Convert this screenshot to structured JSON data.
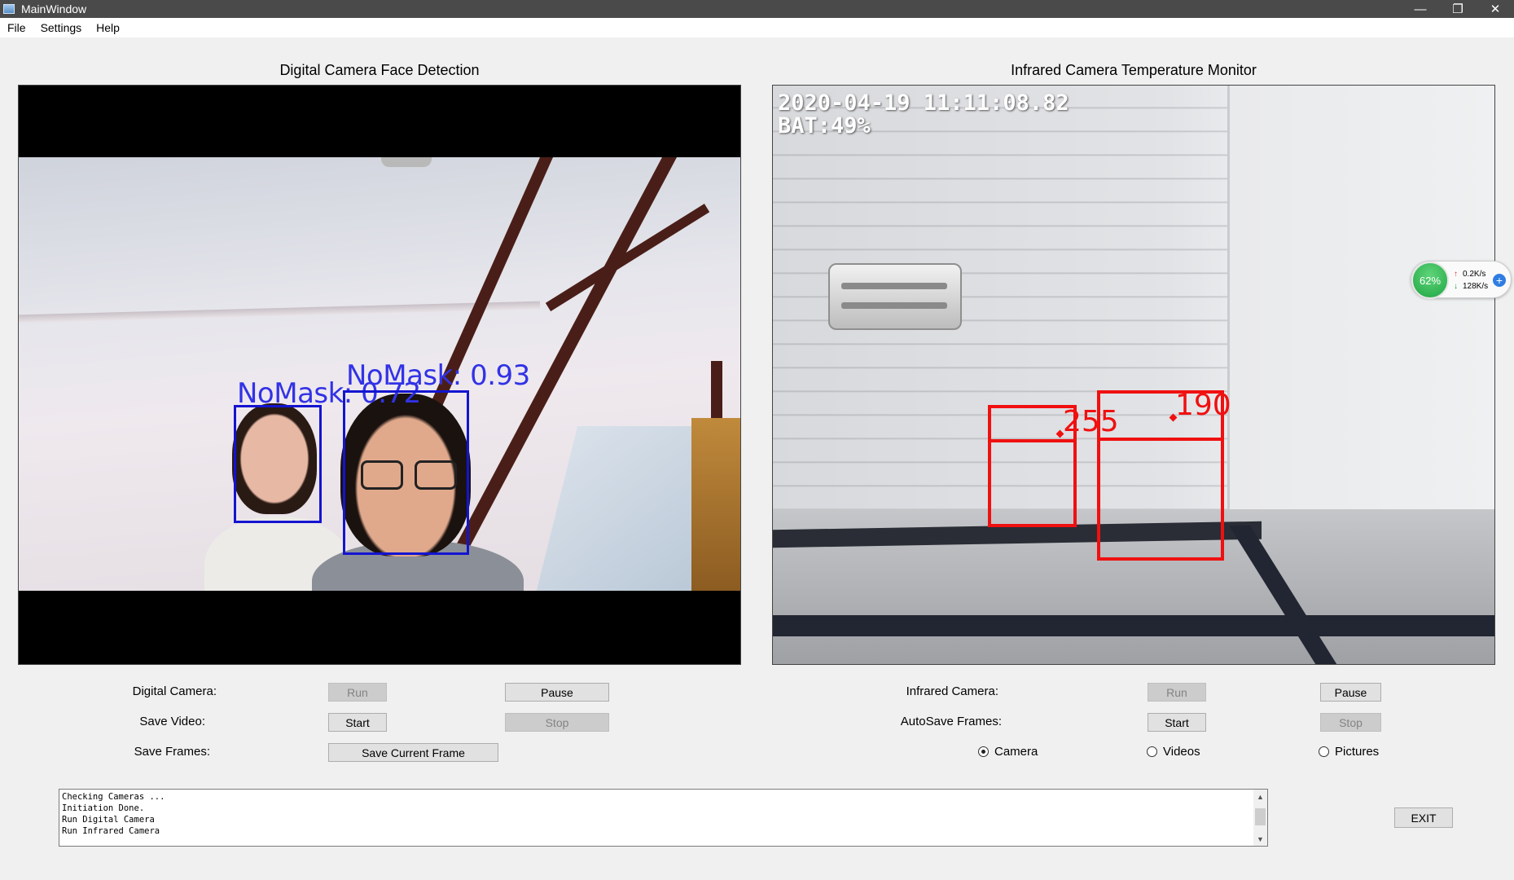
{
  "window": {
    "title": "MainWindow",
    "minimize": "—",
    "restore": "❐",
    "close": "✕"
  },
  "menu": [
    "File",
    "Settings",
    "Help"
  ],
  "digital": {
    "title": "Digital Camera Face Detection",
    "detections": [
      {
        "label": "NoMask: 0.72"
      },
      {
        "label": "NoMask: 0.93"
      }
    ]
  },
  "infrared": {
    "title": "Infrared Camera Temperature Monitor",
    "timestamp": "2020-04-19 11:11:08.82",
    "battery": "BAT:49%",
    "detections": [
      {
        "value": "255"
      },
      {
        "value": "190"
      }
    ]
  },
  "net_widget": {
    "percent": "62%",
    "up": "0.2K/s",
    "down": "128K/s"
  },
  "controls": {
    "digital_camera_label": "Digital Camera:",
    "save_video_label": "Save Video:",
    "save_frames_label": "Save Frames:",
    "run": "Run",
    "pause": "Pause",
    "start": "Start",
    "stop": "Stop",
    "save_current_frame": "Save Current Frame",
    "infrared_camera_label": "Infrared Camera:",
    "autosave_frames_label": "AutoSave Frames:",
    "radio_camera": "Camera",
    "radio_videos": "Videos",
    "radio_pictures": "Pictures",
    "radio_selected": "Camera",
    "exit": "EXIT"
  },
  "log": [
    "Checking Cameras ...",
    "Initiation Done.",
    "Run Digital Camera",
    "Run Infrared Camera"
  ],
  "colors": {
    "face_box": "#1414d0",
    "temp_box": "#f01010",
    "accent": "#1fa642"
  }
}
